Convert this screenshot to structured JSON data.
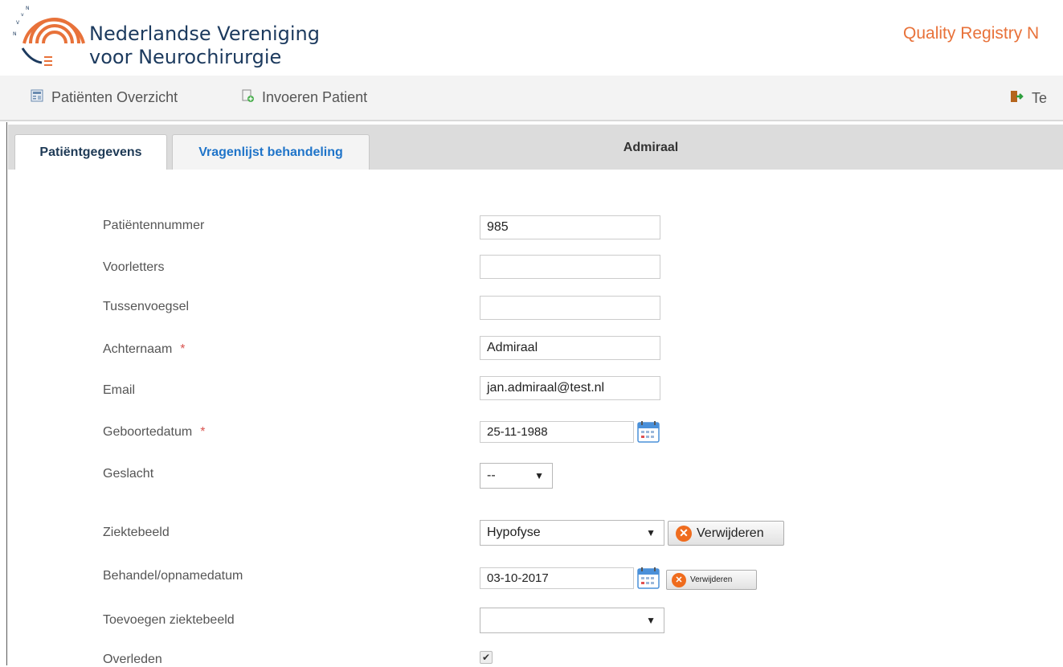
{
  "header": {
    "org_line1": "Nederlandse Vereniging",
    "org_line2": "voor Neurochirurgie",
    "logo_letters": "N V v N",
    "registry_title": "Quality Registry N"
  },
  "nav": {
    "overview": "Patiënten Overzicht",
    "invoer": "Invoeren Patient",
    "logout": "Te"
  },
  "tabs": {
    "tab1": "Patiëntgegevens",
    "tab2": "Vragenlijst behandeling",
    "patient_name": "Admiraal"
  },
  "form": {
    "patientnummer": {
      "label": "Patiëntennummer",
      "value": "985"
    },
    "voorletters": {
      "label": "Voorletters",
      "value": ""
    },
    "tussenvoegsel": {
      "label": "Tussenvoegsel",
      "value": ""
    },
    "achternaam": {
      "label": "Achternaam",
      "value": "Admiraal",
      "required": "*"
    },
    "email": {
      "label": "Email",
      "value": "jan.admiraal@test.nl"
    },
    "geboortedatum": {
      "label": "Geboortedatum",
      "value": "25-11-1988",
      "required": "*"
    },
    "geslacht": {
      "label": "Geslacht",
      "value": "--"
    },
    "ziektebeeld": {
      "label": "Ziektebeeld",
      "value": "Hypofyse",
      "delete_label": "Verwijderen"
    },
    "behandeldatum": {
      "label": "Behandel/opnamedatum",
      "value": "03-10-2017",
      "delete_label": "Verwijderen"
    },
    "toevoegen": {
      "label": "Toevoegen ziektebeeld",
      "value": ""
    },
    "overleden": {
      "label": "Overleden",
      "checked": true
    }
  },
  "colors": {
    "brand_orange": "#e8723a",
    "brand_navy": "#1c3a5e",
    "tab_link": "#1f74c9",
    "required": "#d9534f"
  }
}
